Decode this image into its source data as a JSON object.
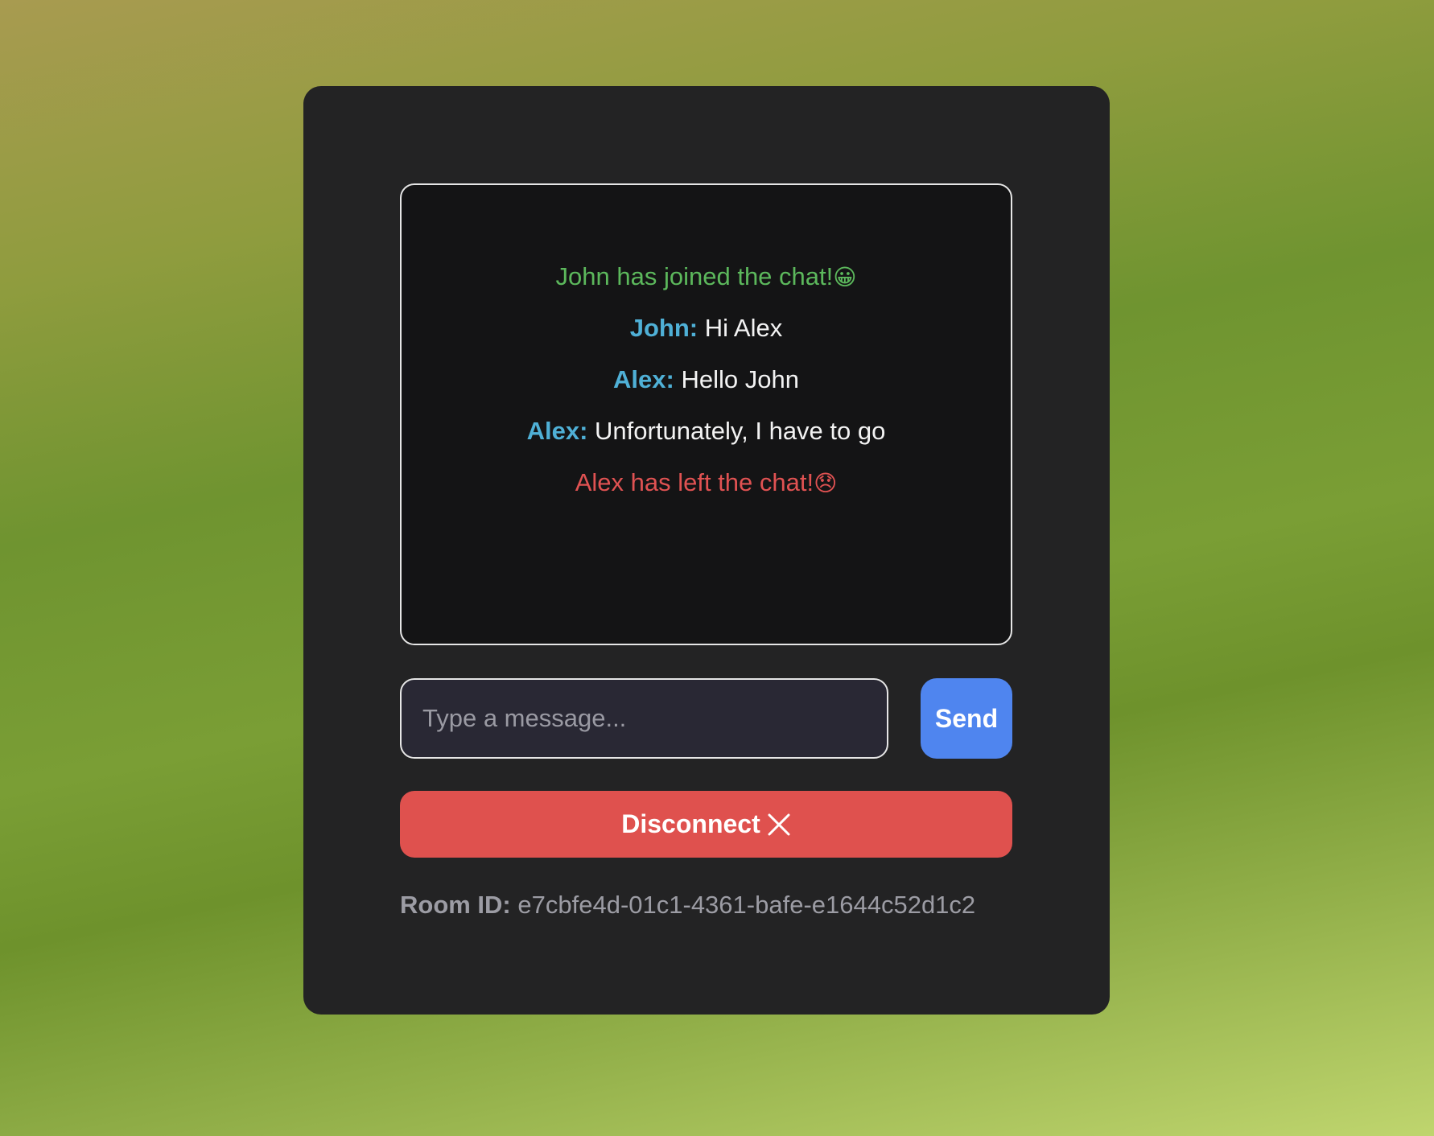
{
  "chat": {
    "messages": [
      {
        "kind": "join",
        "text": "John has joined the chat!",
        "emoji": "😀"
      },
      {
        "kind": "message",
        "user": "John:",
        "text": "Hi Alex"
      },
      {
        "kind": "message",
        "user": "Alex:",
        "text": "Hello John"
      },
      {
        "kind": "message",
        "user": "Alex:",
        "text": "Unfortunately, I have to go"
      },
      {
        "kind": "leave",
        "text": "Alex has left the chat!",
        "emoji": "😞"
      }
    ]
  },
  "composer": {
    "placeholder": "Type a message...",
    "value": "",
    "send_label": "Send"
  },
  "disconnect": {
    "label": "Disconnect",
    "icon": "close-icon"
  },
  "room": {
    "label": "Room ID:",
    "id": "e7cbfe4d-01c1-4361-bafe-e1644c52d1c2"
  },
  "colors": {
    "join": "#5cb85c",
    "leave": "#e05252",
    "username": "#4fb0d6",
    "send": "#4f85ef",
    "disconnect": "#df514e",
    "card": "#232324",
    "chat_bg": "#141415"
  }
}
